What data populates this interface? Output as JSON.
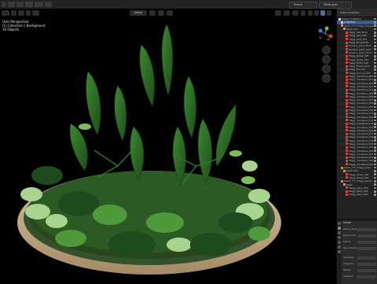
{
  "menubar": {
    "scene_label": "Scene",
    "view_layer_label": "ViewLayer"
  },
  "viewport": {
    "mode_label": "Global",
    "overlay_lines": [
      "User Perspective",
      "(1) Collection | Background",
      "10 Objects"
    ],
    "gizmo_axes": {
      "x": "X",
      "y": "Y",
      "z": "Z"
    }
  },
  "outliner": {
    "header_label": "Scene Collection",
    "rows": [
      {
        "label": "Scene Collection",
        "indent": 0,
        "icon": "collection-icon"
      },
      {
        "label": "Collection",
        "indent": 1,
        "icon": "collection-icon",
        "active": true
      },
      {
        "label": "plant_777_Flagg_Flowerbed",
        "indent": 1,
        "icon": "mesh-icon"
      },
      {
        "label": "Mesh 011",
        "indent": 2,
        "icon": "mesh-icon"
      },
      {
        "label": "Flagg_000_Bulb",
        "indent": 3,
        "icon": "material-icon"
      },
      {
        "label": "Flagg_leaf_000",
        "indent": 3,
        "icon": "material-icon"
      },
      {
        "label": "Flagg_Leaf_001",
        "indent": 3,
        "icon": "material-icon"
      },
      {
        "label": "Flagg_Flowerbed",
        "indent": 3,
        "icon": "material-icon"
      },
      {
        "label": "banana_plant_Bark",
        "indent": 3,
        "icon": "material-icon"
      },
      {
        "label": "banana_plant_Leaf",
        "indent": 3,
        "icon": "material-icon"
      },
      {
        "label": "banana_plant_Stem",
        "indent": 3,
        "icon": "material-icon"
      },
      {
        "label": "Flagg_Grass_000",
        "indent": 3,
        "icon": "material-icon"
      },
      {
        "label": "Flagg_Grass_001",
        "indent": 3,
        "icon": "material-icon"
      },
      {
        "label": "Flagg_Dried_leaf",
        "indent": 3,
        "icon": "material-icon"
      },
      {
        "label": "Flagg_Dried_stem",
        "indent": 3,
        "icon": "material-icon"
      },
      {
        "label": "Flagg_Ground",
        "indent": 3,
        "icon": "material-icon"
      },
      {
        "label": "Flagg_Ground_001",
        "indent": 3,
        "icon": "material-icon"
      },
      {
        "label": "Flagg_monstera_000",
        "indent": 3,
        "icon": "material-icon"
      },
      {
        "label": "Flagg_monstera_001",
        "indent": 3,
        "icon": "material-icon"
      },
      {
        "label": "Flagg_monstera_002",
        "indent": 3,
        "icon": "material-icon"
      },
      {
        "label": "Flagg_monstera_003",
        "indent": 3,
        "icon": "material-icon"
      },
      {
        "label": "Flagg_monstera_004",
        "indent": 3,
        "icon": "material-icon"
      },
      {
        "label": "Flagg_monstera_005",
        "indent": 3,
        "icon": "material-icon"
      },
      {
        "label": "Flagg_monstera_006",
        "indent": 3,
        "icon": "material-icon"
      },
      {
        "label": "Flagg_monstera_007",
        "indent": 3,
        "icon": "material-icon"
      },
      {
        "label": "Flagg_monstera_008",
        "indent": 3,
        "icon": "material-icon"
      },
      {
        "label": "Flagg_monstera_009",
        "indent": 3,
        "icon": "material-icon"
      },
      {
        "label": "Flagg_monstera_010",
        "indent": 3,
        "icon": "material-icon"
      },
      {
        "label": "Flagg_monstera_011",
        "indent": 3,
        "icon": "material-icon"
      },
      {
        "label": "Flagg_monstera_012",
        "indent": 3,
        "icon": "material-icon"
      },
      {
        "label": "Flagg_monstera_013",
        "indent": 3,
        "icon": "material-icon"
      },
      {
        "label": "Flagg_monstera_014",
        "indent": 3,
        "icon": "material-icon"
      },
      {
        "label": "Flagg_monstera_015",
        "indent": 3,
        "icon": "material-icon"
      },
      {
        "label": "Flagg_monstera_016",
        "indent": 3,
        "icon": "material-icon"
      },
      {
        "label": "Flagg_monstera_017",
        "indent": 3,
        "icon": "material-icon"
      },
      {
        "label": "Flagg_monstera_018",
        "indent": 3,
        "icon": "material-icon"
      },
      {
        "label": "Flagg_monstera_019",
        "indent": 3,
        "icon": "material-icon"
      },
      {
        "label": "Flagg_monstera_020",
        "indent": 3,
        "icon": "material-icon"
      },
      {
        "label": "Flagg_monstera_021",
        "indent": 3,
        "icon": "material-icon"
      },
      {
        "label": "Flagg_monstera_022",
        "indent": 3,
        "icon": "material-icon"
      },
      {
        "label": "Flagg_monstera_023",
        "indent": 3,
        "icon": "material-icon"
      },
      {
        "label": "Flagg_monstera_024",
        "indent": 3,
        "icon": "material-icon"
      },
      {
        "label": "Flagg_monstera_025",
        "indent": 3,
        "icon": "material-icon"
      },
      {
        "label": "Flagg_monstera_026",
        "indent": 3,
        "icon": "material-icon"
      },
      {
        "label": "plant_777_Flagg_grass",
        "indent": 1,
        "icon": "mesh-icon"
      },
      {
        "label": "Mesh 012",
        "indent": 2,
        "icon": "mesh-icon"
      },
      {
        "label": "Flagg_Grass_000",
        "indent": 3,
        "icon": "material-icon"
      },
      {
        "label": "Flagg_Grass_001",
        "indent": 3,
        "icon": "material-icon"
      },
      {
        "label": "plant_777_Flagg_plants",
        "indent": 1,
        "icon": "mesh-icon"
      },
      {
        "label": "Mesh",
        "indent": 2,
        "icon": "mesh-icon"
      },
      {
        "label": "Flagg_plant_000",
        "indent": 3,
        "icon": "material-icon"
      },
      {
        "label": "Flagg_plant_001",
        "indent": 3,
        "icon": "material-icon"
      },
      {
        "label": "Flagg_plant_002",
        "indent": 3,
        "icon": "material-icon"
      }
    ]
  },
  "properties": {
    "panel_title": "Scene",
    "rows": [
      {
        "label": "Render Engine"
      },
      {
        "label": "Feature Set"
      },
      {
        "label": "Device"
      },
      {
        "label": "Open Shading Language"
      },
      {
        "label": "Sampling"
      },
      {
        "label": "Integrator"
      },
      {
        "label": "Render"
      },
      {
        "label": "Viewport"
      }
    ]
  },
  "colors": {
    "ui_dark": "#1d1d1d",
    "ui_panel": "#2b2b2b",
    "selection": "#3b5a86",
    "pot_rim": "#c4ad88",
    "leaf_dark": "#1e4a1e",
    "leaf_mid": "#2f7a2a",
    "leaf_light": "#9fd08a"
  }
}
